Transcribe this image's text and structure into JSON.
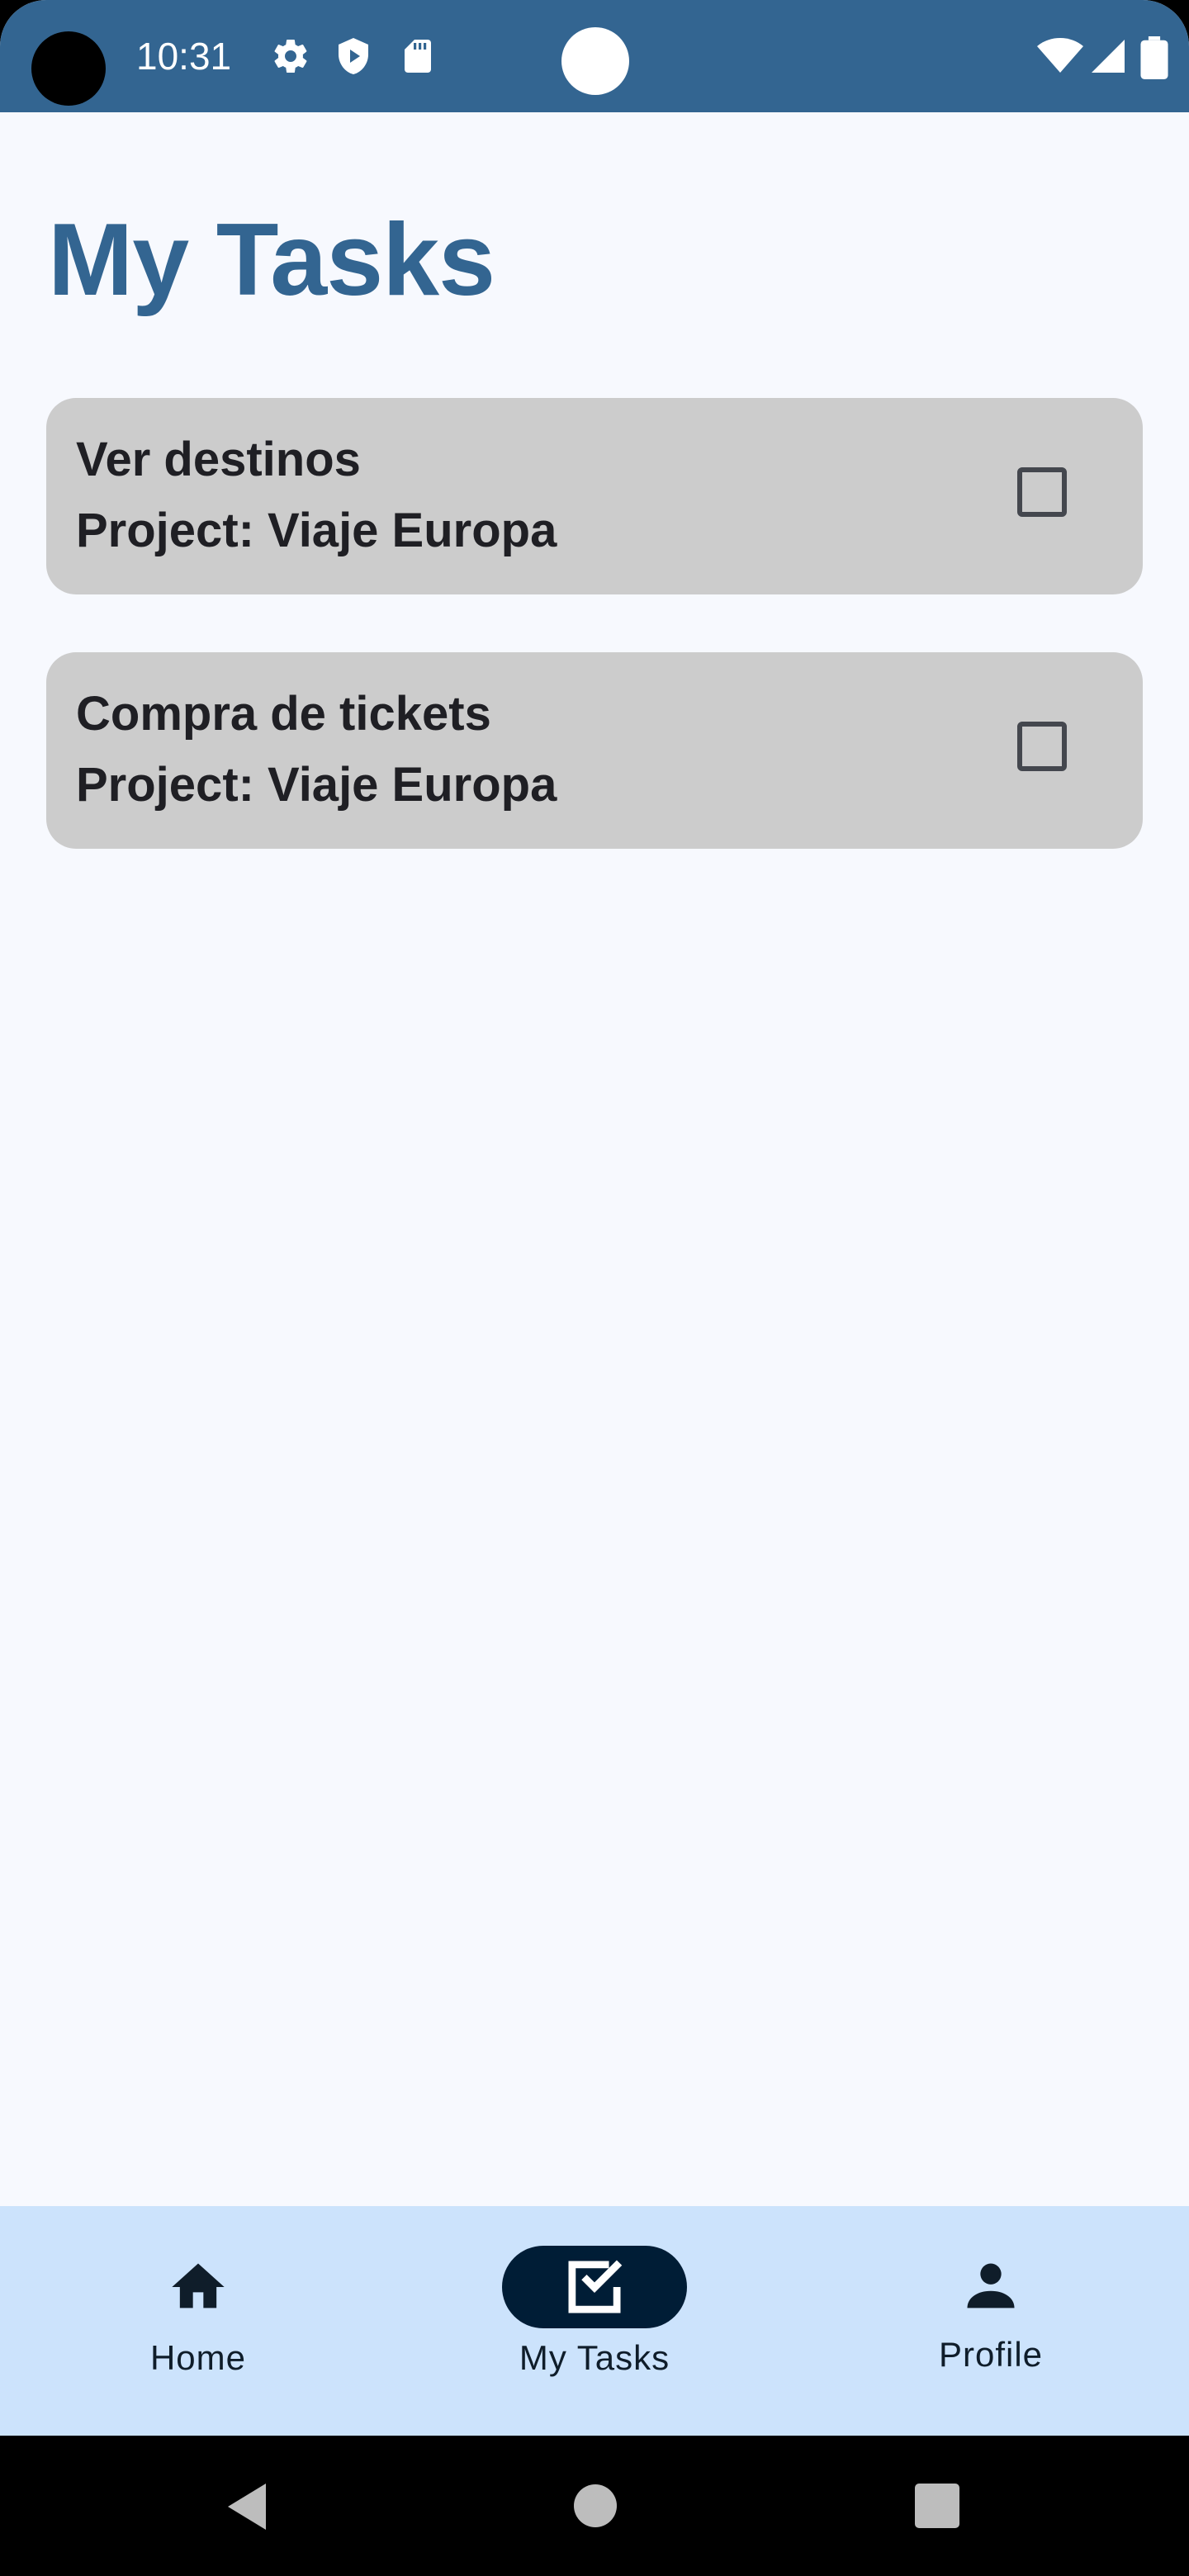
{
  "status_bar": {
    "time": "10:31",
    "background": "#336591",
    "icons": [
      "settings-icon",
      "shield-play-icon",
      "sd-card-icon",
      "wifi-icon",
      "signal-icon",
      "battery-icon"
    ]
  },
  "page": {
    "title": "My Tasks",
    "title_color": "#336591"
  },
  "tasks": [
    {
      "name": "Ver destinos",
      "project_line": "Project: Viaje Europa",
      "checked": false
    },
    {
      "name": "Compra de tickets",
      "project_line": "Project: Viaje Europa",
      "checked": false
    }
  ],
  "bottom_nav": {
    "items": [
      {
        "label": "Home",
        "icon": "home-icon",
        "active": false
      },
      {
        "label": "My Tasks",
        "icon": "task-check-icon",
        "active": true
      },
      {
        "label": "Profile",
        "icon": "person-icon",
        "active": false
      }
    ],
    "background": "#cce3fc",
    "active_pill_color": "#001d36"
  },
  "system_nav": {
    "buttons": [
      "back-icon",
      "home-circle-icon",
      "recents-icon"
    ]
  }
}
